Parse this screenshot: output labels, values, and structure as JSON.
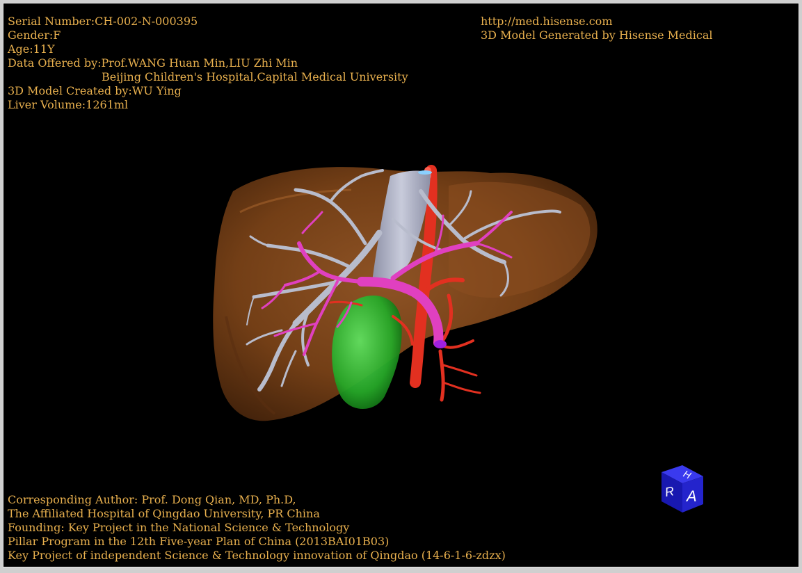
{
  "info": {
    "serial_number": "Serial Number:CH-002-N-000395",
    "gender": "Gender:F",
    "age": "Age:11Y",
    "data_offered": "Data Offered by:Prof.WANG Huan Min,LIU Zhi Min",
    "institution": "Beijing Children's Hospital,Capital Medical University",
    "created_by": "3D Model Created by:WU Ying",
    "liver_volume": "Liver Volume:1261ml"
  },
  "brand": {
    "url": "http://med.hisense.com",
    "generated_by": "3D Model Generated by Hisense Medical"
  },
  "credits": {
    "line1": "Corresponding Author: Prof. Dong Qian, MD, Ph.D,",
    "line2": "The Affiliated Hospital of Qingdao University, PR China",
    "line3": "Founding: Key Project in the National Science & Technology",
    "line4": "Pillar Program in the 12th Five-year Plan of China (2013BAI01B03)",
    "line5": "Key Project of independent Science & Technology innovation of Qingdao (14-6-1-6-zdzx)"
  },
  "orientation_cube": {
    "face_front": "A",
    "face_left": "R",
    "face_top": "H"
  },
  "colors": {
    "text": "#e8b04e",
    "liver": "#8a4a1c",
    "hepatic_vein": "#b8bccc",
    "portal_vein": "#e040c0",
    "artery": "#e23020",
    "gallbladder": "#27b82a",
    "cube": "#2020c8"
  }
}
